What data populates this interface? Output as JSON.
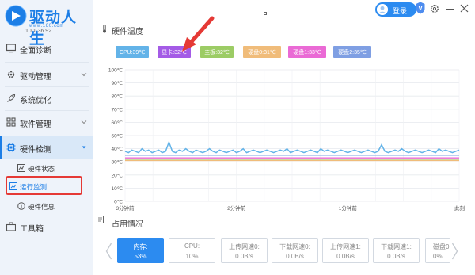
{
  "app": {
    "name": "驱动人生",
    "url": "www.160.com",
    "version": "10.1.36.92"
  },
  "header": {
    "login_label": "登录",
    "vip_badge": "V"
  },
  "sidebar": {
    "items": [
      {
        "label": "全面诊断",
        "icon": "monitor-icon"
      },
      {
        "label": "驱动管理",
        "icon": "gear-icon",
        "chevron": true
      },
      {
        "label": "系统优化",
        "icon": "rocket-icon"
      },
      {
        "label": "软件管理",
        "icon": "grid-icon",
        "chevron": true
      },
      {
        "label": "硬件检测",
        "icon": "chip-icon",
        "chevron": true,
        "active": true
      },
      {
        "label": "工具箱",
        "icon": "toolbox-icon"
      }
    ],
    "sub_items": [
      {
        "label": "硬件状态",
        "icon": "status-icon"
      },
      {
        "label": "运行监测",
        "icon": "monitor-chart-icon",
        "selected": true
      },
      {
        "label": "硬件信息",
        "icon": "info-icon"
      }
    ]
  },
  "temp_section": {
    "title": "硬件温度",
    "legends": [
      {
        "label": "CPU:39℃",
        "color": "#63b3e8"
      },
      {
        "label": "显卡:32℃",
        "color": "#a45be6"
      },
      {
        "label": "主板:32℃",
        "color": "#9ccc65"
      },
      {
        "label": "硬盘0:31℃",
        "color": "#f0bc7a"
      },
      {
        "label": "硬盘1:33℃",
        "color": "#ea6ad5"
      },
      {
        "label": "硬盘2:35℃",
        "color": "#7f9fe3"
      }
    ]
  },
  "chart_data": {
    "type": "line",
    "ylabels": [
      "100℃",
      "90℃",
      "80℃",
      "70℃",
      "60℃",
      "50℃",
      "40℃",
      "30℃",
      "20℃",
      "10℃",
      "0℃"
    ],
    "ylim": [
      0,
      100
    ],
    "xlabels": [
      "3分钟前",
      "2分钟前",
      "1分钟前",
      "此刻"
    ],
    "grid": true,
    "series": [
      {
        "name": "CPU",
        "color": "#63b3e8",
        "values": [
          38,
          37,
          39,
          38,
          37,
          40,
          38,
          39,
          37,
          38,
          39,
          37,
          38,
          45,
          38,
          37,
          39,
          38,
          40,
          38,
          37,
          39,
          38,
          37,
          38,
          40,
          38,
          37,
          39,
          38,
          37,
          38,
          39,
          37,
          38,
          40,
          37,
          38,
          39,
          38,
          37,
          38,
          39,
          38,
          37,
          38,
          39,
          38,
          40,
          37,
          38,
          39,
          38,
          37,
          38,
          39,
          38,
          37,
          40,
          38,
          39,
          38,
          37,
          38,
          39,
          38,
          37,
          38,
          39,
          38,
          37,
          38,
          39,
          38,
          37,
          38,
          43,
          38,
          37,
          38,
          39,
          38,
          40,
          38,
          37,
          38,
          39,
          38,
          37,
          38,
          39,
          38,
          37,
          40,
          38,
          39,
          38,
          37,
          38,
          39
        ]
      },
      {
        "name": "显卡",
        "color": "#a45be6",
        "values": [
          32,
          32
        ]
      },
      {
        "name": "主板",
        "color": "#9ccc65",
        "values": [
          32,
          32
        ]
      },
      {
        "name": "硬盘0",
        "color": "#f0bc7a",
        "values": [
          31,
          31
        ]
      },
      {
        "name": "硬盘1",
        "color": "#ea6ad5",
        "values": [
          33,
          33
        ]
      },
      {
        "name": "硬盘2",
        "color": "#7f9fe3",
        "values": [
          35,
          35
        ]
      }
    ]
  },
  "usage_section": {
    "title": "占用情况",
    "cards": [
      {
        "title": "内存:",
        "value": "53%",
        "active": true
      },
      {
        "title": "CPU:",
        "value": "10%"
      },
      {
        "title": "上传网速0:",
        "value": "0.0B/s"
      },
      {
        "title": "下载网速0:",
        "value": "0.0B/s"
      },
      {
        "title": "上传网速1:",
        "value": "0.0B/s"
      },
      {
        "title": "下载网速1:",
        "value": "0.0B/s"
      },
      {
        "title": "磁盘0:",
        "value": "0%"
      }
    ]
  },
  "colors": {
    "accent": "#2c8bf0",
    "sidebar_bg": "#eef3fa",
    "highlight_red": "#e53935"
  }
}
